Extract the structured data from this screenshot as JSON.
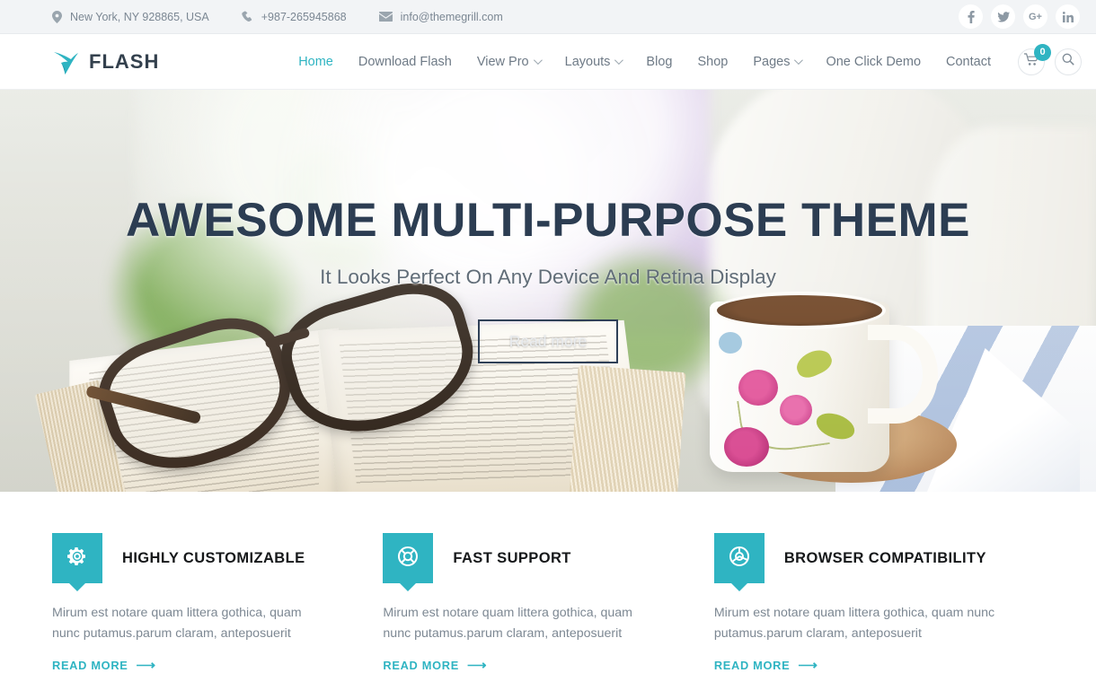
{
  "topbar": {
    "address": "New York, NY 928865, USA",
    "phone": "+987-265945868",
    "email": "info@themegrill.com",
    "icons": {
      "address": "map-marker-icon",
      "phone": "phone-icon",
      "email": "envelope-icon"
    },
    "socials": [
      {
        "name": "facebook-icon",
        "glyph": "f"
      },
      {
        "name": "twitter-icon",
        "glyph": "t"
      },
      {
        "name": "google-plus-icon",
        "glyph": "G+"
      },
      {
        "name": "linkedin-icon",
        "glyph": "in"
      }
    ]
  },
  "header": {
    "logo_icon": "flash-bird-logo-icon",
    "brand": "FLASH",
    "nav": [
      {
        "label": "Home",
        "active": true,
        "dropdown": false
      },
      {
        "label": "Download Flash",
        "active": false,
        "dropdown": false
      },
      {
        "label": "View Pro",
        "active": false,
        "dropdown": true
      },
      {
        "label": "Layouts",
        "active": false,
        "dropdown": true
      },
      {
        "label": "Blog",
        "active": false,
        "dropdown": false
      },
      {
        "label": "Shop",
        "active": false,
        "dropdown": false
      },
      {
        "label": "Pages",
        "active": false,
        "dropdown": true
      },
      {
        "label": "One Click Demo",
        "active": false,
        "dropdown": false
      },
      {
        "label": "Contact",
        "active": false,
        "dropdown": false
      }
    ],
    "cart": {
      "icon": "shopping-cart-icon",
      "count": "0"
    },
    "search": {
      "icon": "search-icon"
    }
  },
  "hero": {
    "title": "AWESOME MULTI-PURPOSE THEME",
    "subtitle": "It Looks Perfect On Any Device And Retina Display",
    "button": "Read more",
    "image_description": "Open book with eyeglasses, floral coffee mug on wooden coaster, lilac flowers in vase"
  },
  "features": [
    {
      "icon": "gear-icon",
      "title": "HIGHLY CUSTOMIZABLE",
      "text": "Mirum est notare quam littera gothica, quam nunc putamus.parum claram, anteposuerit",
      "link": "READ MORE"
    },
    {
      "icon": "life-ring-icon",
      "title": "FAST SUPPORT",
      "text": "Mirum est notare quam littera gothica, quam nunc putamus.parum claram, anteposuerit",
      "link": "READ MORE"
    },
    {
      "icon": "chrome-browser-icon",
      "title": "BROWSER COMPATIBILITY",
      "text": "Mirum est notare quam littera gothica, quam nunc putamus.parum claram, anteposuerit",
      "link": "READ MORE"
    }
  ],
  "colors": {
    "accent": "#2fb4c2",
    "topbar_bg": "#f2f4f6",
    "heading": "#2c3d52",
    "body_text": "#7d8893",
    "title_dark": "#16181a"
  }
}
